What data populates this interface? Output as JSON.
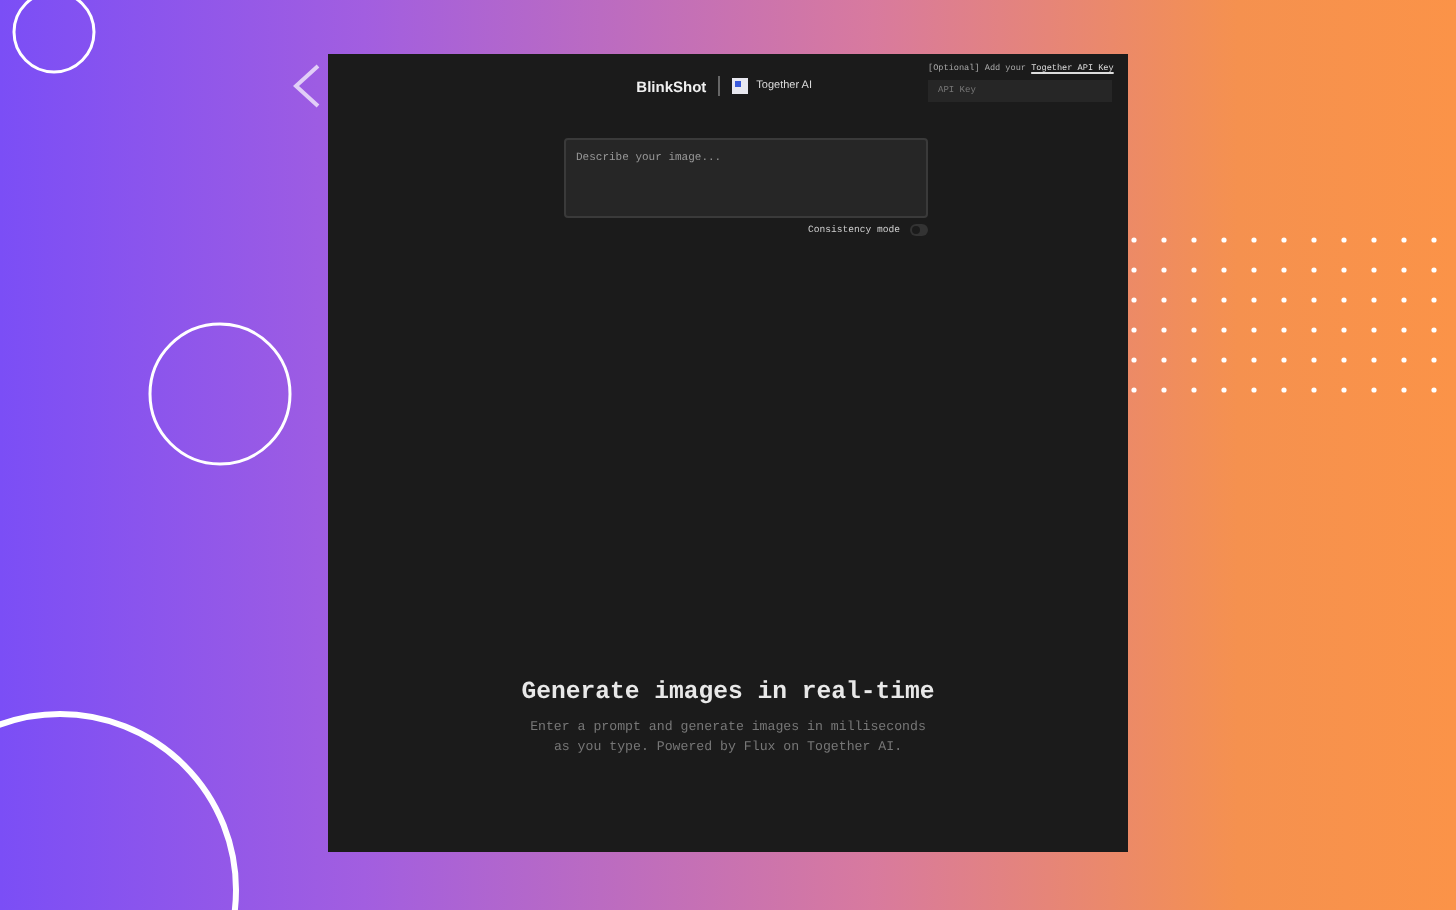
{
  "header": {
    "logo": "BlinkShot",
    "partner": "Together AI"
  },
  "api_key": {
    "label": "[Optional] Add your ",
    "link": "Together API Key",
    "placeholder": "API Key"
  },
  "prompt": {
    "placeholder": "Describe your image..."
  },
  "consistency_mode": {
    "label": "Consistency mode",
    "on": false
  },
  "hero": {
    "title": "Generate images in real-time",
    "subtitle": "Enter a prompt and generate images in milliseconds as you type. Powered by Flux on Together AI."
  }
}
